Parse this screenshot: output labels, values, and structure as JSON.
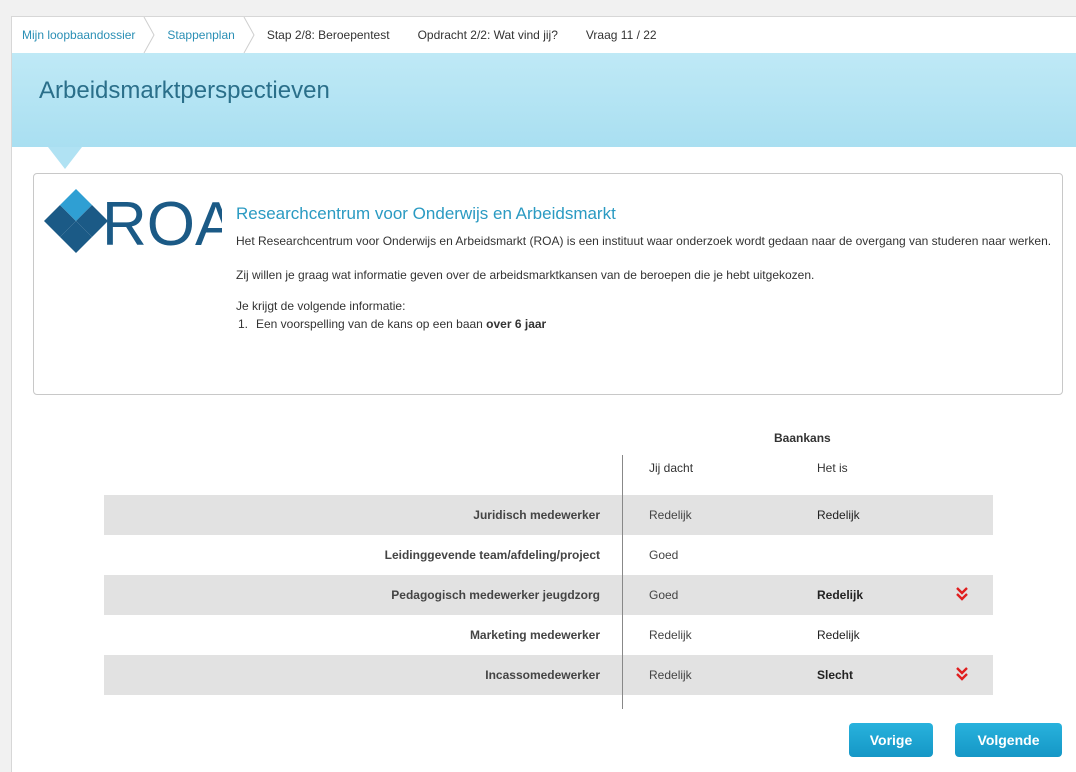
{
  "breadcrumb": {
    "items": [
      {
        "label": "Mijn loopbaandossier",
        "link": true
      },
      {
        "label": "Stappenplan",
        "link": true
      },
      {
        "label": "Stap 2/8: Beroepentest",
        "link": false
      },
      {
        "label": "Opdracht 2/2: Wat vind jij?",
        "link": false
      },
      {
        "label": "Vraag 11 / 22",
        "link": false
      }
    ]
  },
  "header": {
    "title": "Arbeidsmarktperspectieven"
  },
  "info": {
    "logo_text": "ROA",
    "title": "Researchcentrum voor Onderwijs en Arbeidsmarkt",
    "paragraph1": "Het Researchcentrum voor Onderwijs en Arbeidsmarkt (ROA) is een instituut waar onderzoek wordt gedaan naar de overgang van studeren naar werken.",
    "paragraph2": "Zij willen je graag wat informatie geven over de arbeidsmarktkansen van de beroepen die je hebt uitgekozen.",
    "list_intro": "Je krijgt de volgende informatie:",
    "list_item_number": "1.",
    "list_item_text": "Een voorspelling van de kans op een baan ",
    "list_item_bold": "over 6 jaar"
  },
  "table": {
    "group_header": "Baankans",
    "col_thought": "Jij dacht",
    "col_actual": "Het is",
    "rows": [
      {
        "name": "Juridisch medewerker",
        "thought": "Redelijk",
        "actual": "Redelijk",
        "warning": false
      },
      {
        "name": "Leidinggevende team/afdeling/project",
        "thought": "Goed",
        "actual": "",
        "warning": false
      },
      {
        "name": "Pedagogisch medewerker jeugdzorg",
        "thought": "Goed",
        "actual": "Redelijk",
        "warning": true
      },
      {
        "name": "Marketing medewerker",
        "thought": "Redelijk",
        "actual": "Redelijk",
        "warning": false
      },
      {
        "name": "Incassomedewerker",
        "thought": "Redelijk",
        "actual": "Slecht",
        "warning": true
      }
    ]
  },
  "buttons": {
    "prev": "Vorige",
    "next": "Volgende"
  },
  "colors": {
    "accent": "#2a9ac2",
    "band": "#b0e2f3",
    "logo": "#1b5a86",
    "warning": "#e02020",
    "button": "#1aa3d2"
  },
  "icons": {
    "warning": "double-chevron-down-icon",
    "separator": "chevron-right-icon"
  }
}
